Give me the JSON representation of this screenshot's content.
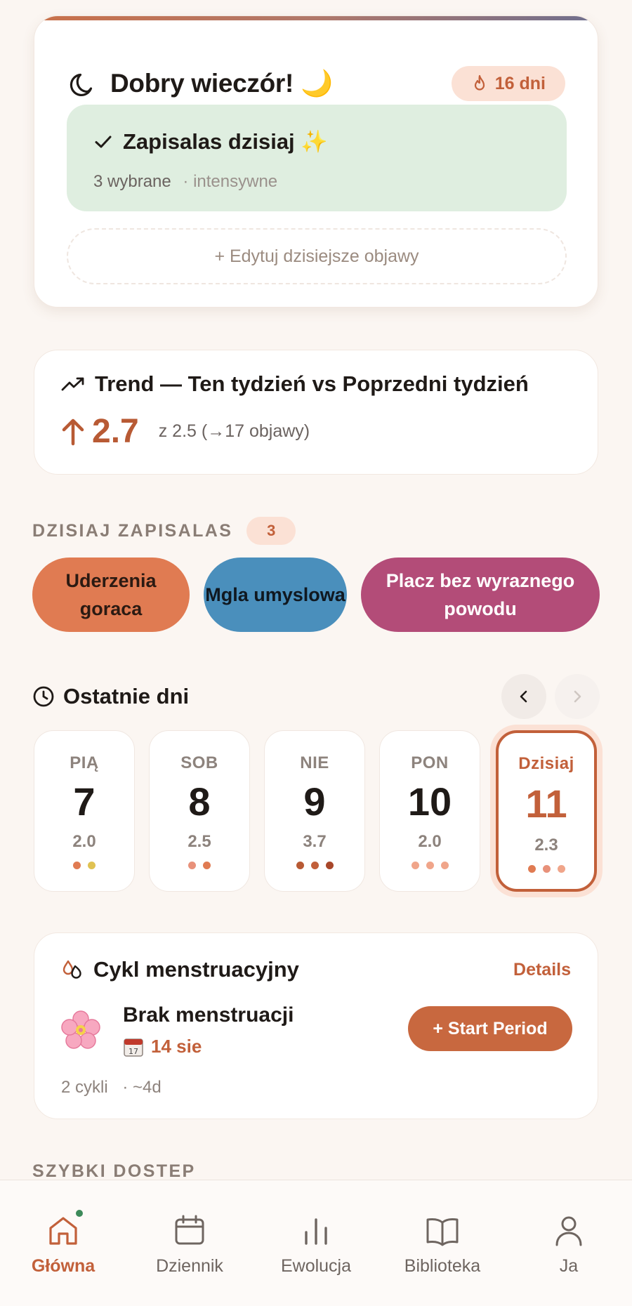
{
  "greeting": {
    "title": "Dobry wieczór! 🌙",
    "streak": "16 dni",
    "logged_title": "Zapisalas dzisiaj ✨",
    "logged_count": "3 wybrane",
    "logged_intensity": "· intensywne",
    "edit_button": "+ Edytuj dzisiejsze objawy"
  },
  "trend": {
    "title": "Trend — Ten tydzień vs Poprzedni tydzień",
    "value": "2.7",
    "subtitle": "z 2.5 (→17 objawy)"
  },
  "today_logged": {
    "label": "DZISIAJ ZAPISALAS",
    "count": "3",
    "chips": [
      "Uderzenia goraca",
      "Mgla umyslowa",
      "Placz bez wyraznego powodu"
    ]
  },
  "recent_days": {
    "title": "Ostatnie dni",
    "days": [
      {
        "dow": "PIĄ",
        "num": "7",
        "score": "2.0",
        "dots": [
          "#e07b52",
          "#e0c252"
        ]
      },
      {
        "dow": "SOB",
        "num": "8",
        "score": "2.5",
        "dots": [
          "#e8917a",
          "#e07b52"
        ]
      },
      {
        "dow": "NIE",
        "num": "9",
        "score": "3.7",
        "dots": [
          "#b85a34",
          "#c2603a",
          "#a8472a"
        ]
      },
      {
        "dow": "PON",
        "num": "10",
        "score": "2.0",
        "dots": [
          "#f0a58a",
          "#f0a58a",
          "#f0a58a"
        ]
      },
      {
        "dow": "Dzisiaj",
        "num": "11",
        "score": "2.3",
        "dots": [
          "#e07b52",
          "#e8917a",
          "#f0a58a"
        ]
      }
    ]
  },
  "cycle": {
    "title": "Cykl menstruacyjny",
    "details": "Details",
    "status": "Brak menstruacji",
    "date": "14 sie",
    "start_button": "+ Start Period",
    "cycles": "2 cykli",
    "avg": "· ~4d"
  },
  "quick_access": {
    "label": "SZYBKI DOSTEP"
  },
  "bottom_nav": {
    "items": [
      {
        "label": "Główna",
        "icon": "home-icon"
      },
      {
        "label": "Dziennik",
        "icon": "calendar-icon"
      },
      {
        "label": "Ewolucja",
        "icon": "bar-chart-icon"
      },
      {
        "label": "Biblioteka",
        "icon": "book-icon"
      },
      {
        "label": "Ja",
        "icon": "user-icon"
      }
    ]
  },
  "colors": {
    "accent": "#c2603a",
    "background": "#fbf6f2",
    "logged_bg": "#dfeee0",
    "chip_hot_flash": "#e07b52",
    "chip_brain_fog": "#4a8fbc",
    "chip_crying": "#b34c78"
  }
}
